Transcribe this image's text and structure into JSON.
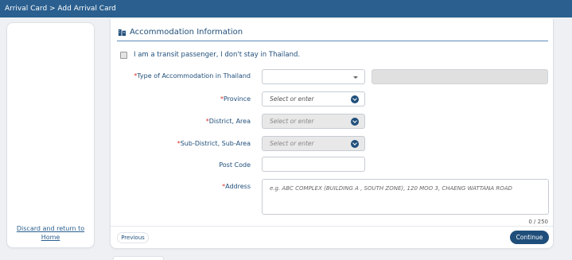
{
  "breadcrumb": "Arrival Card > Add Arrival Card",
  "sidebar": {
    "discard_link": "Discard and return to Home"
  },
  "section": {
    "title": "Accommodation Information",
    "icon": "building-icon"
  },
  "transit": {
    "label": "I am a transit passenger, I don't stay in Thailand.",
    "checked": false
  },
  "fields": {
    "accommodation_type": {
      "label": "Type of Accommodation in Thailand",
      "required": true,
      "value": ""
    },
    "province": {
      "label": "Province",
      "required": true,
      "placeholder": "Select or enter"
    },
    "district": {
      "label": "District, Area",
      "required": true,
      "placeholder": "Select or enter"
    },
    "sub_district": {
      "label": "Sub-District, Sub-Area",
      "required": true,
      "placeholder": "Select or enter"
    },
    "post_code": {
      "label": "Post Code",
      "required": false,
      "value": ""
    },
    "address": {
      "label": "Address",
      "required": true,
      "placeholder": "e.g. ABC COMPLEX (BUILDING A , SOUTH ZONE), 120 MOO 3, CHAENG WATTANA ROAD",
      "counter": "0 / 250"
    }
  },
  "required_marker": "*",
  "buttons": {
    "previous": "Previous",
    "continue": "Continue"
  },
  "colors": {
    "header": "#2a5f8f",
    "primary": "#1f4e7a",
    "required": "#d9342b"
  }
}
